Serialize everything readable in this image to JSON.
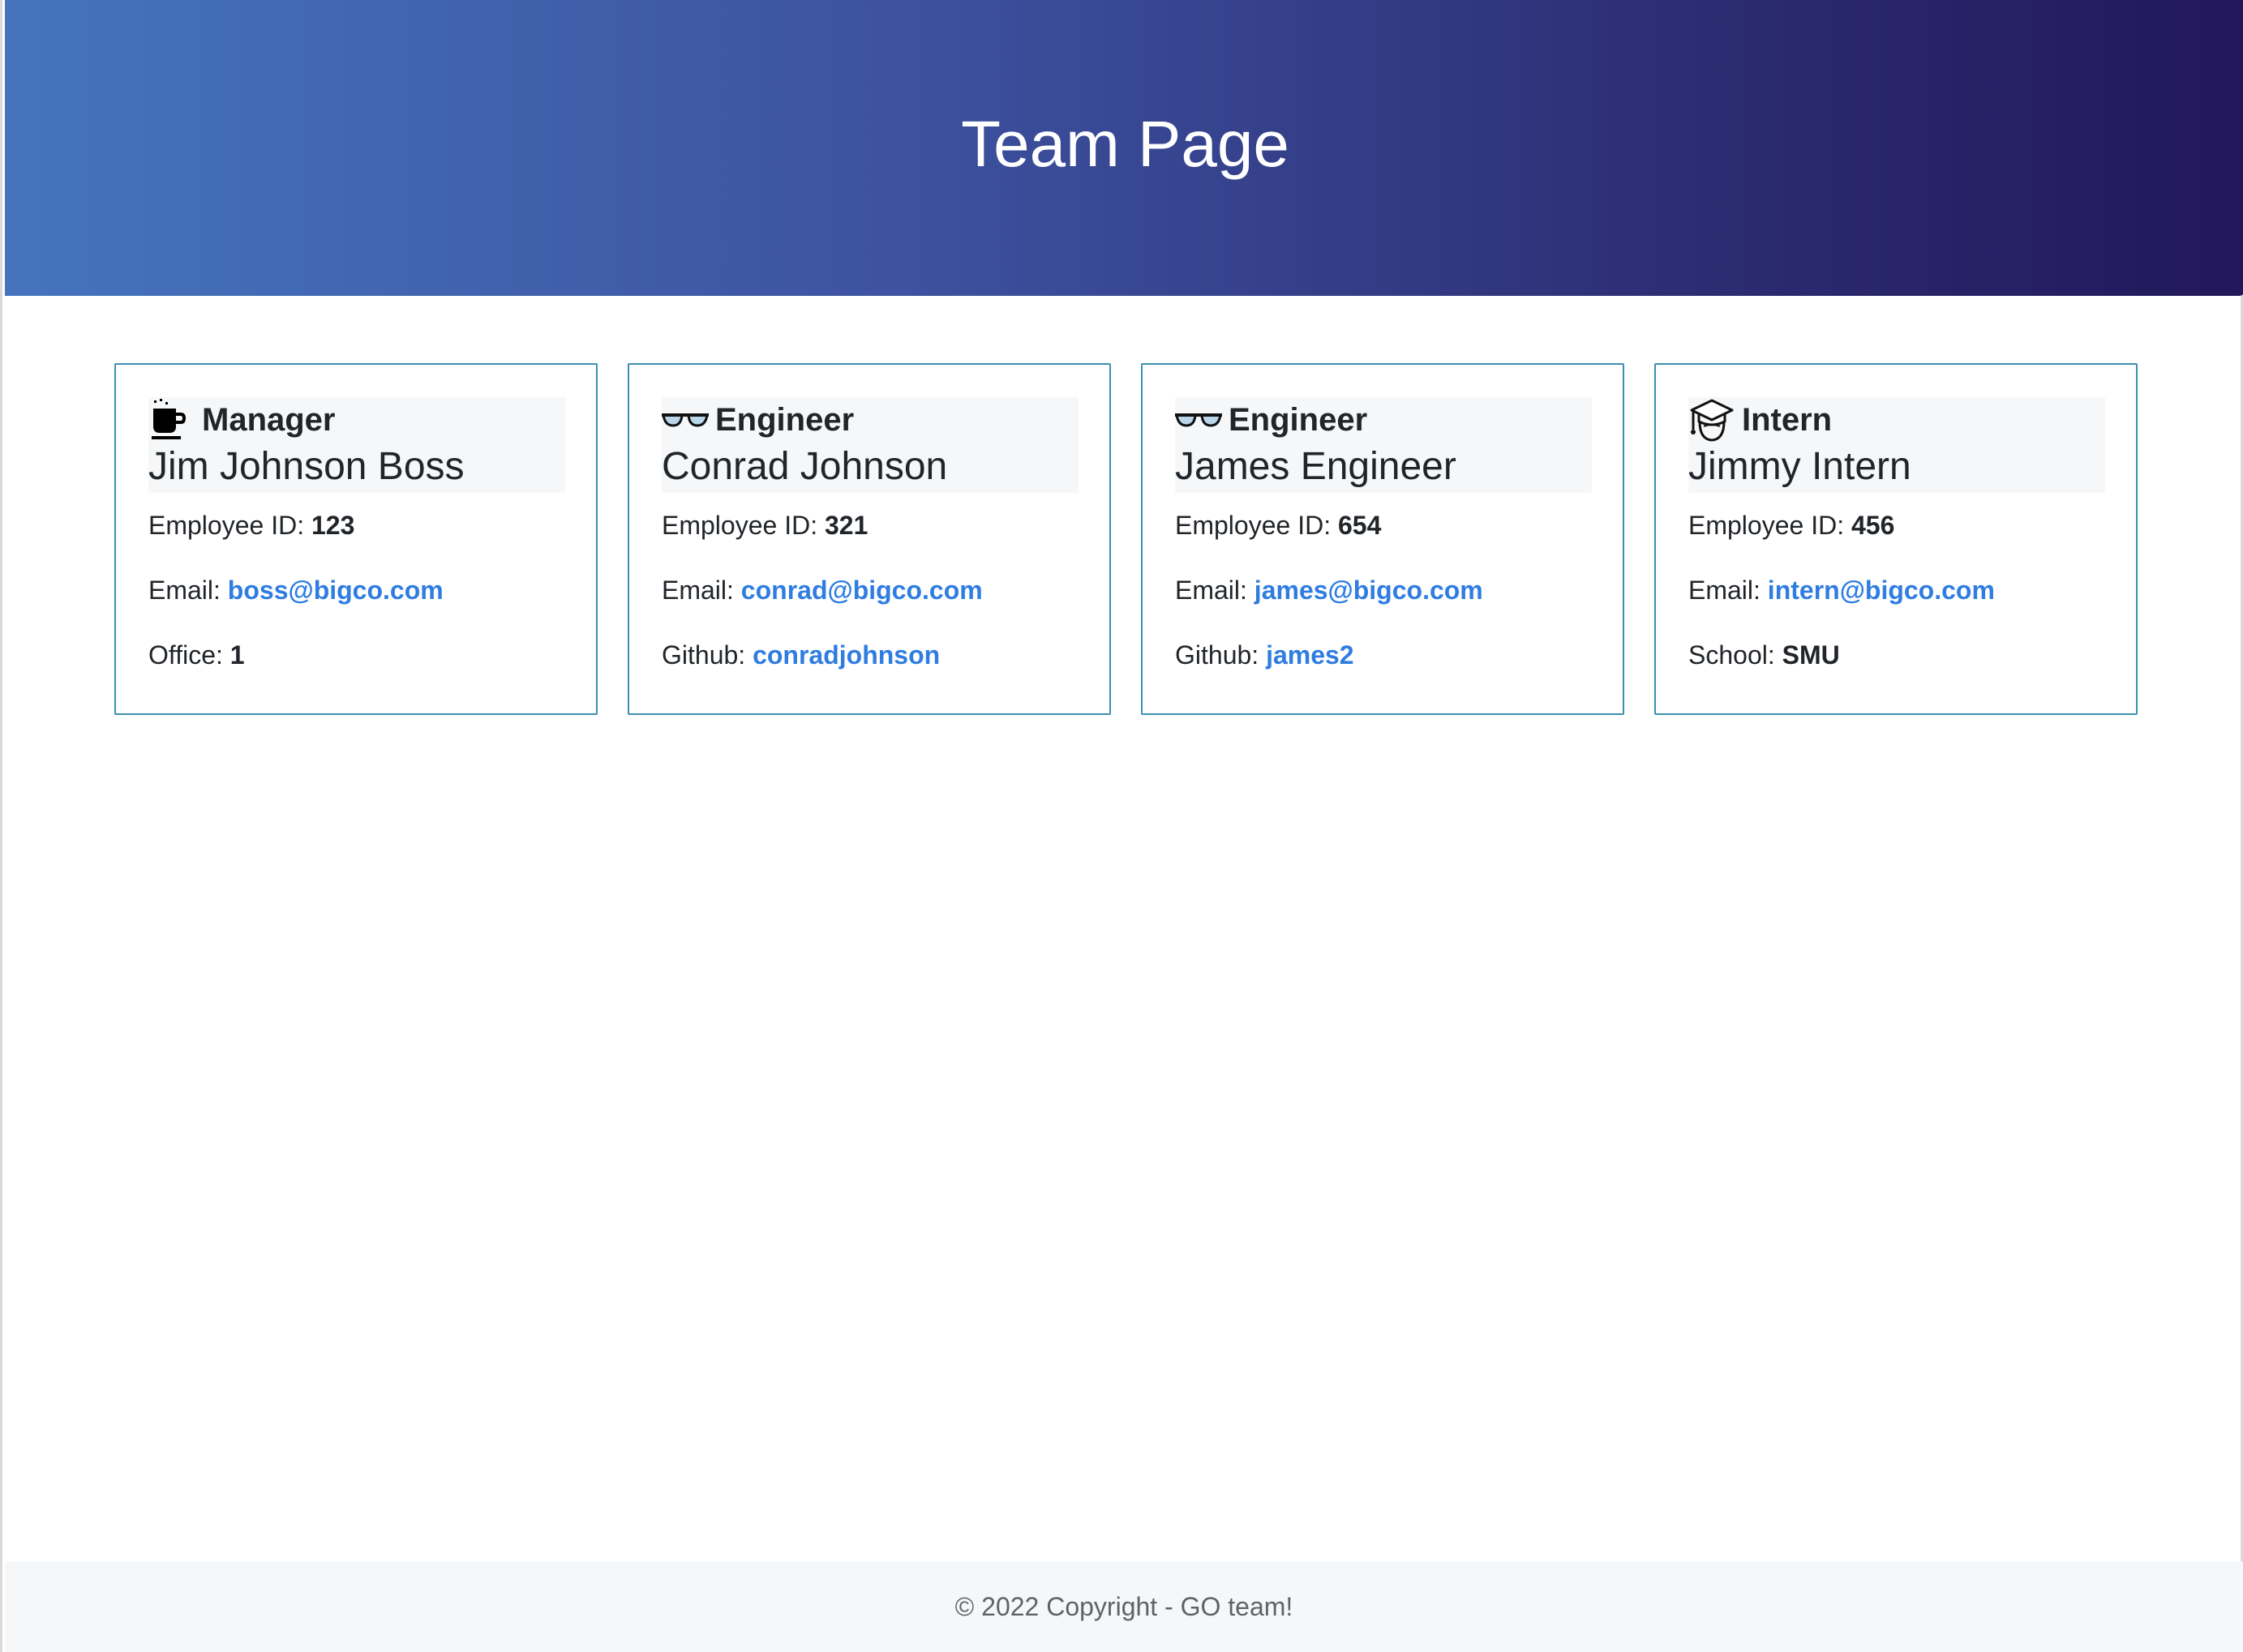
{
  "header": {
    "title": "Team Page",
    "gradient_start": "#4574bd",
    "gradient_end": "#22175a"
  },
  "cards": [
    {
      "role": "Manager",
      "icon": "coffee-mug-icon",
      "name": "Jim Johnson Boss",
      "id_label": "Employee ID:",
      "id": "123",
      "email_label": "Email:",
      "email": "boss@bigco.com",
      "extra_label": "Office:",
      "extra": "1"
    },
    {
      "role": "Engineer",
      "icon": "glasses-icon",
      "name": "Conrad Johnson",
      "id_label": "Employee ID:",
      "id": "321",
      "email_label": "Email:",
      "email": "conrad@bigco.com",
      "extra_label": "Github:",
      "extra": "conradjohnson"
    },
    {
      "role": "Engineer",
      "icon": "glasses-icon",
      "name": "James Engineer",
      "id_label": "Employee ID:",
      "id": "654",
      "email_label": "Email:",
      "email": "james@bigco.com",
      "extra_label": "Github:",
      "extra": "james2"
    },
    {
      "role": "Intern",
      "icon": "graduate-icon",
      "name": "Jimmy Intern",
      "id_label": "Employee ID:",
      "id": "456",
      "email_label": "Email:",
      "email": "intern@bigco.com",
      "extra_label": "School:",
      "extra": "SMU"
    }
  ],
  "footer": {
    "text": "© 2022 Copyright - GO team!"
  },
  "colors": {
    "card_border": "#3d8fb0",
    "link": "#2f7de1",
    "card_head_bg": "#f6f7f9",
    "footer_bg": "#f6f7f9"
  }
}
